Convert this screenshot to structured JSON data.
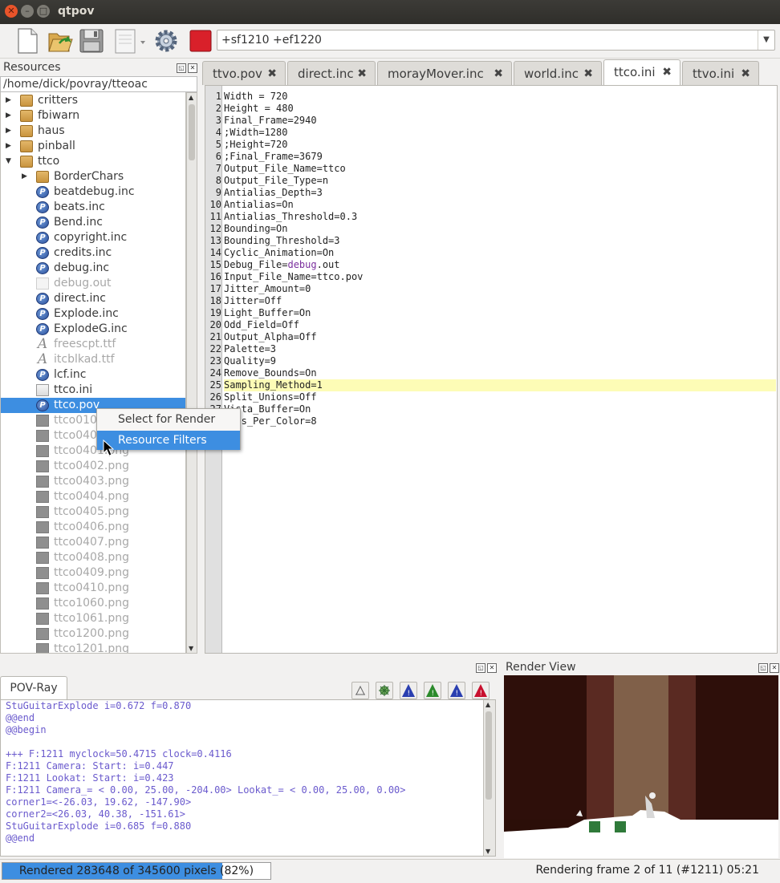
{
  "window": {
    "title": "qtpov"
  },
  "toolbar": {
    "command_value": "+sf1210 +ef1220",
    "colors": {
      "render_button": "#d9202a"
    }
  },
  "resources": {
    "title": "Resources",
    "path": "/home/dick/povray/tteoac",
    "items": [
      {
        "label": "critters",
        "type": "folder",
        "depth": 0,
        "expanded": false
      },
      {
        "label": "fbiwarn",
        "type": "folder",
        "depth": 0,
        "expanded": false
      },
      {
        "label": "haus",
        "type": "folder",
        "depth": 0,
        "expanded": false
      },
      {
        "label": "pinball",
        "type": "folder",
        "depth": 0,
        "expanded": false
      },
      {
        "label": "ttco",
        "type": "folder-open",
        "depth": 0,
        "expanded": true
      },
      {
        "label": "BorderChars",
        "type": "folder",
        "depth": 1,
        "expanded": false
      },
      {
        "label": "beatdebug.inc",
        "type": "pov",
        "depth": 1
      },
      {
        "label": "beats.inc",
        "type": "pov",
        "depth": 1
      },
      {
        "label": "Bend.inc",
        "type": "pov",
        "depth": 1
      },
      {
        "label": "copyright.inc",
        "type": "pov",
        "depth": 1
      },
      {
        "label": "credits.inc",
        "type": "pov",
        "depth": 1
      },
      {
        "label": "debug.inc",
        "type": "pov",
        "depth": 1
      },
      {
        "label": "debug.out",
        "type": "txt",
        "depth": 1,
        "grey": true
      },
      {
        "label": "direct.inc",
        "type": "pov",
        "depth": 1
      },
      {
        "label": "Explode.inc",
        "type": "pov",
        "depth": 1
      },
      {
        "label": "ExplodeG.inc",
        "type": "pov",
        "depth": 1
      },
      {
        "label": "freescpt.ttf",
        "type": "font",
        "depth": 1,
        "grey": true
      },
      {
        "label": "itcblkad.ttf",
        "type": "font",
        "depth": 1,
        "grey": true
      },
      {
        "label": "lcf.inc",
        "type": "pov",
        "depth": 1
      },
      {
        "label": "ttco.ini",
        "type": "ini",
        "depth": 1
      },
      {
        "label": "ttco.pov",
        "type": "pov",
        "depth": 1,
        "selected": true
      },
      {
        "label": "ttco0100.png",
        "type": "img",
        "depth": 1,
        "grey": true
      },
      {
        "label": "ttco0400.png",
        "type": "img",
        "depth": 1,
        "grey": true
      },
      {
        "label": "ttco0401.png",
        "type": "img",
        "depth": 1,
        "grey": true
      },
      {
        "label": "ttco0402.png",
        "type": "img",
        "depth": 1,
        "grey": true
      },
      {
        "label": "ttco0403.png",
        "type": "img",
        "depth": 1,
        "grey": true
      },
      {
        "label": "ttco0404.png",
        "type": "img",
        "depth": 1,
        "grey": true
      },
      {
        "label": "ttco0405.png",
        "type": "img",
        "depth": 1,
        "grey": true
      },
      {
        "label": "ttco0406.png",
        "type": "img",
        "depth": 1,
        "grey": true
      },
      {
        "label": "ttco0407.png",
        "type": "img",
        "depth": 1,
        "grey": true
      },
      {
        "label": "ttco0408.png",
        "type": "img",
        "depth": 1,
        "grey": true
      },
      {
        "label": "ttco0409.png",
        "type": "img",
        "depth": 1,
        "grey": true
      },
      {
        "label": "ttco0410.png",
        "type": "img",
        "depth": 1,
        "grey": true
      },
      {
        "label": "ttco1060.png",
        "type": "img",
        "depth": 1,
        "grey": true
      },
      {
        "label": "ttco1061.png",
        "type": "img",
        "depth": 1,
        "grey": true
      },
      {
        "label": "ttco1200.png",
        "type": "img",
        "depth": 1,
        "grey": true
      },
      {
        "label": "ttco1201.png",
        "type": "img",
        "depth": 1,
        "grey": true
      }
    ]
  },
  "context_menu": {
    "items": [
      {
        "label": "Select for Render",
        "highlighted": false
      },
      {
        "label": "Resource Filters",
        "highlighted": true
      }
    ]
  },
  "editor": {
    "tabs": [
      {
        "label": "ttvo.pov",
        "active": false
      },
      {
        "label": "direct.inc",
        "active": false
      },
      {
        "label": "morayMover.inc",
        "active": false
      },
      {
        "label": "world.inc",
        "active": false
      },
      {
        "label": "ttco.ini",
        "active": true
      },
      {
        "label": "ttvo.ini",
        "active": false
      }
    ],
    "highlighted_line": 25,
    "lines": [
      "Width = 720",
      "Height = 480",
      "Final_Frame=2940",
      ";Width=1280",
      ";Height=720",
      ";Final_Frame=3679",
      "Output_File_Name=ttco",
      "Output_File_Type=n",
      "Antialias_Depth=3",
      "Antialias=On",
      "Antialias_Threshold=0.3",
      "Bounding=On",
      "Bounding_Threshold=3",
      "Cyclic_Animation=On",
      "Debug_File=debug.out",
      "Input_File_Name=ttco.pov",
      "Jitter_Amount=0",
      "Jitter=Off",
      "Light_Buffer=On",
      "Odd_Field=Off",
      "Output_Alpha=Off",
      "Palette=3",
      "Quality=9",
      "Remove_Bounds=On",
      "Sampling_Method=1",
      "Split_Unions=Off",
      "Vista_Buffer=On",
      "Bits_Per_Color=8"
    ]
  },
  "povray_panel": {
    "tab_label": "POV-Ray",
    "console_lines": [
      "StuGuitarExplode i=0.672 f=0.870",
      "@@end",
      "@@begin",
      "",
      "+++ F:1211 myclock=50.4715 clock=0.4116",
      "F:1211 Camera: Start: i=0.447",
      "F:1211 Lookat: Start: i=0.423",
      "F:1211 Camera_= < 0.00, 25.00, -204.00> Lookat_= < 0.00, 25.00, 0.00>",
      "corner1=<-26.03, 19.62, -147.90>",
      "corner2=<26.03, 40.38, -151.61>",
      "StuGuitarExplode i=0.685 f=0.880",
      "@@end"
    ]
  },
  "render_view": {
    "title": "Render View"
  },
  "status": {
    "progress_text": "Rendered 283648 of 345600 pixels (82%)",
    "progress_fraction": 0.82,
    "frame_text": "Rendering frame 2 of 11 (#1211)  05:21"
  }
}
